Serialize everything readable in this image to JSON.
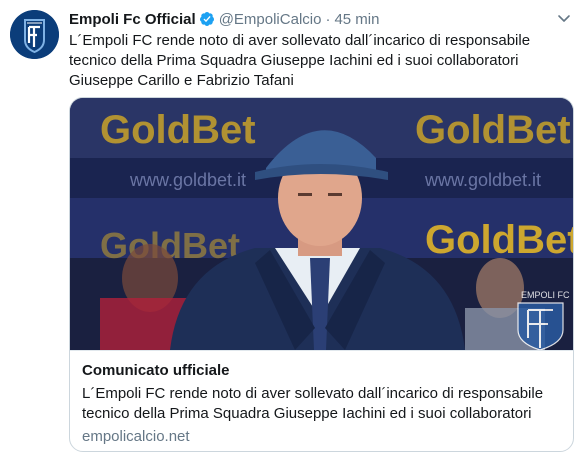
{
  "tweet": {
    "author_name": "Empoli Fc Official",
    "handle": "@EmpoliCalcio",
    "separator": "·",
    "time": "45 min",
    "text": "L´Empoli FC rende noto di aver sollevato dall´incarico di responsabile tecnico della Prima Squadra Giuseppe Iachini ed i suoi collaboratori Giuseppe Carillo e Fabrizio Tafani"
  },
  "card": {
    "title": "Comunicato ufficiale",
    "description": "L´Empoli FC rende noto di aver sollevato dall´incarico di responsabile tecnico della Prima Squadra Giuseppe Iachini ed i suoi collaboratori Giuse...",
    "domain": "empolicalcio.net",
    "image_banner_text": "GoldBet",
    "image_banner_url": "www.goldbet.it",
    "watermark_text": "EMPOLI FC"
  },
  "icons": {
    "avatar": "empoli-crest-icon",
    "verified": "verified-badge-icon",
    "menu": "chevron-down-icon"
  },
  "colors": {
    "accent": "#1da1f2",
    "text_primary": "#14171a",
    "text_secondary": "#657786",
    "border": "#ccd6dd",
    "crest_blue": "#0b3d7a"
  }
}
